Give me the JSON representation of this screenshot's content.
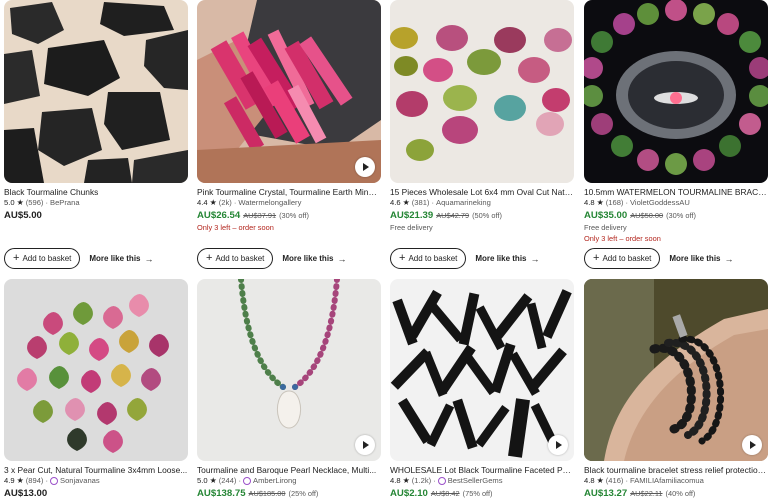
{
  "listings": [
    {
      "title": "Black Tourmaline Chunks",
      "rating": "5.0",
      "star": "★",
      "reviews": "(596)",
      "separator": "·",
      "seller": "BePrana",
      "price": "AU$5.00",
      "original_price": "",
      "discount": "",
      "urgency": "",
      "shipping": "",
      "video": false,
      "star_seller": false,
      "add_label": "Add to basket",
      "more_label": "More like this"
    },
    {
      "title": "Pink Tourmaline Crystal, Tourmaline Earth Mineral...",
      "rating": "4.4",
      "star": "★",
      "reviews": "(2k)",
      "separator": "·",
      "seller": "Watermelongallery",
      "price": "AU$26.54",
      "original_price": "AU$37.91",
      "discount": "(30% off)",
      "urgency": "Only 3 left – order soon",
      "shipping": "",
      "video": true,
      "star_seller": false,
      "add_label": "Add to basket",
      "more_label": "More like this"
    },
    {
      "title": "15 Pieces Wholesale Lot 6x4 mm Oval Cut Natural...",
      "rating": "4.6",
      "star": "★",
      "reviews": "(381)",
      "separator": "·",
      "seller": "Aquamarineking",
      "price": "AU$21.39",
      "original_price": "AU$42.79",
      "discount": "(50% off)",
      "urgency": "",
      "shipping": "Free delivery",
      "video": false,
      "star_seller": false,
      "add_label": "Add to basket",
      "more_label": "More like this"
    },
    {
      "title": "10.5mm WATERMELON TOURMALINE BRACELET...",
      "rating": "4.8",
      "star": "★",
      "reviews": "(168)",
      "separator": "·",
      "seller": "VioletGoddessAU",
      "price": "AU$35.00",
      "original_price": "AU$50.00",
      "discount": "(30% off)",
      "urgency": "Only 3 left – order soon",
      "shipping": "Free delivery",
      "video": false,
      "star_seller": false,
      "add_label": "Add to basket",
      "more_label": "More like this"
    },
    {
      "title": "3 x Pear Cut, Natural Tourmaline 3x4mm Loose...",
      "rating": "4.9",
      "star": "★",
      "reviews": "(894)",
      "separator": "·",
      "seller": "Sonjavanas",
      "price": "AU$13.00",
      "original_price": "",
      "discount": "",
      "urgency": "",
      "shipping": "",
      "video": false,
      "star_seller": true,
      "add_label": "",
      "more_label": ""
    },
    {
      "title": "Tourmaline and Baroque Pearl Necklace, Multi...",
      "rating": "5.0",
      "star": "★",
      "reviews": "(244)",
      "separator": "·",
      "seller": "AmberLirong",
      "price": "AU$138.75",
      "original_price": "AU$185.00",
      "discount": "(25% off)",
      "urgency": "",
      "shipping": "",
      "video": true,
      "star_seller": true,
      "add_label": "",
      "more_label": ""
    },
    {
      "title": "WHOLESALE Lot Black Tourmaline Faceted Pencil...",
      "rating": "4.8",
      "star": "★",
      "reviews": "(1.2k)",
      "separator": "·",
      "seller": "BestSellerGems",
      "price": "AU$2.10",
      "original_price": "AU$8.42",
      "discount": "(75% off)",
      "urgency": "",
      "shipping": "",
      "video": true,
      "star_seller": true,
      "add_label": "",
      "more_label": ""
    },
    {
      "title": "Black tourmaline bracelet stress relief protection...",
      "rating": "4.8",
      "star": "★",
      "reviews": "(416)",
      "separator": "·",
      "seller": "FAMILIAfamiliacomua",
      "price": "AU$13.27",
      "original_price": "AU$22.11",
      "discount": "(40% off)",
      "urgency": "",
      "shipping": "",
      "video": true,
      "star_seller": false,
      "add_label": "",
      "more_label": ""
    }
  ],
  "colors": {
    "sale_price": "#258635",
    "urgency": "#b3261e",
    "star_seller": "#9b50c9"
  },
  "icons": {
    "video": "play-icon",
    "add": "plus-icon",
    "more": "arrow-right-icon",
    "rating": "star-icon",
    "star_seller": "star-seller-badge-icon"
  }
}
